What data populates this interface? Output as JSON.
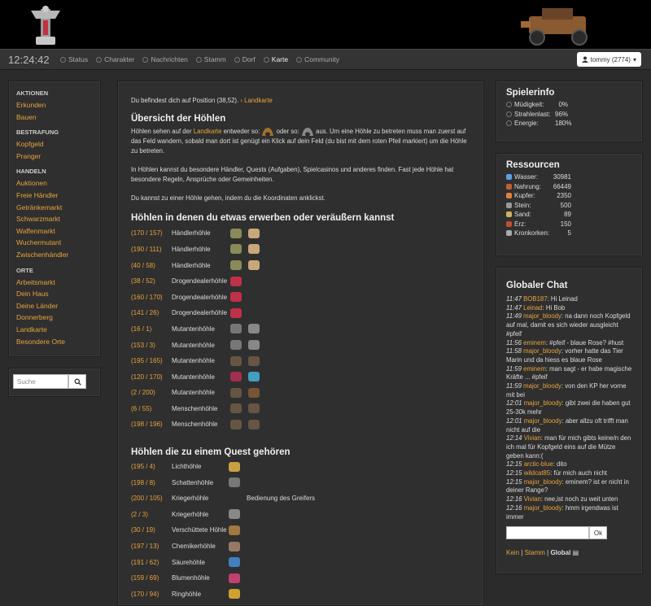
{
  "header": {
    "clock": "12:24:42"
  },
  "nav": {
    "items": [
      "Status",
      "Charakter",
      "Nachrichten",
      "Stamm",
      "Dorf",
      "Karte",
      "Community"
    ],
    "active": "Karte",
    "user": "tommy (2774)"
  },
  "sidebar": {
    "groups": [
      {
        "title": "AKTIONEN",
        "items": [
          "Erkunden",
          "Bauen"
        ]
      },
      {
        "title": "BESTRAFUNG",
        "items": [
          "Kopfgeld",
          "Pranger"
        ]
      },
      {
        "title": "HANDELN",
        "items": [
          "Auktionen",
          "Freie Händler",
          "Getränkemarkt",
          "Schwarzmarkt",
          "Waffenmarkt",
          "Wuchermutant",
          "Zwischenhändler"
        ]
      },
      {
        "title": "ORTE",
        "items": [
          "Arbeitsmarkt",
          "Dein Haus",
          "Deine Länder",
          "Donnerberg",
          "Landkarte",
          "Besondere Orte"
        ]
      }
    ]
  },
  "search": {
    "placeholder": "Suche"
  },
  "main": {
    "position_text": "Du befindest dich auf Position (38,52).",
    "position_link": "› Landkarte",
    "title": "Übersicht der Höhlen",
    "intro_a": "Höhlen sehen auf der",
    "intro_link": "Landkarte",
    "intro_b": "entweder so:",
    "intro_c": "oder so:",
    "intro_d": "aus. Um eine Höhle zu betreten muss man zuerst auf das Feld wandern, sobald man dort ist genügt ein Klick auf dein Feld (du bist mit dem roten Pfeil markiert) um die Höhle zu betreten.",
    "para2": "In Höhlen kannst du besondere Händler, Quests (Aufgaben), Spielcasinos und anderes finden. Fast jede Höhle hat besondere Regeln, Ansprüche oder Gemeinheiten.",
    "para3": "Du kannst zu einer Höhle gehen, indem du die Koordinaten anklickst.",
    "trade_title": "Höhlen in denen du etwas erwerben oder veräußern kannst",
    "trade_caves": [
      {
        "coord": "(170 / 157)",
        "name": "Händlerhöhle",
        "c1": "#8a8a5a",
        "c2": "#c8a878"
      },
      {
        "coord": "(190 / 111)",
        "name": "Händlerhöhle",
        "c1": "#8a8a5a",
        "c2": "#c8a878"
      },
      {
        "coord": "(40 / 58)",
        "name": "Händlerhöhle",
        "c1": "#8a8a5a",
        "c2": "#c8a878"
      },
      {
        "coord": "(38 / 52)",
        "name": "Drogendealerhöhle",
        "c1": "#c0304a",
        "c2": ""
      },
      {
        "coord": "(160 / 170)",
        "name": "Drogendealerhöhle",
        "c1": "#c0304a",
        "c2": ""
      },
      {
        "coord": "(141 / 26)",
        "name": "Drogendealerhöhle",
        "c1": "#c0304a",
        "c2": ""
      },
      {
        "coord": "(16 / 1)",
        "name": "Mutantenhöhle",
        "c1": "#777",
        "c2": "#888"
      },
      {
        "coord": "(153 / 3)",
        "name": "Mutantenhöhle",
        "c1": "#777",
        "c2": "#888"
      },
      {
        "coord": "(195 / 165)",
        "name": "Mutantenhöhle",
        "c1": "#665544",
        "c2": "#665544"
      },
      {
        "coord": "(120 / 170)",
        "name": "Mutantenhöhle",
        "c1": "#a03050",
        "c2": "#40a0c0"
      },
      {
        "coord": "(2 / 200)",
        "name": "Mutantenhöhle",
        "c1": "#665544",
        "c2": "#775533"
      },
      {
        "coord": "(6 / 55)",
        "name": "Menschenhöhle",
        "c1": "#665544",
        "c2": "#665544"
      },
      {
        "coord": "(198 / 196)",
        "name": "Menschenhöhle",
        "c1": "#665544",
        "c2": "#665544"
      }
    ],
    "quest_title": "Höhlen die zu einem Quest gehören",
    "quest_caves": [
      {
        "coord": "(195 / 4)",
        "name": "Lichthöhle",
        "c1": "#c8a040",
        "extra": ""
      },
      {
        "coord": "(198 / 8)",
        "name": "Schattenhöhle",
        "c1": "#777",
        "extra": ""
      },
      {
        "coord": "(200 / 105)",
        "name": "Kriegerhöhle",
        "c1": "",
        "extra": "Bedienung des Greifers"
      },
      {
        "coord": "(2 / 3)",
        "name": "Kriegerhöhle",
        "c1": "#888",
        "extra": ""
      },
      {
        "coord": "(30 / 19)",
        "name": "Verschüttete Höhle",
        "c1": "#a07840",
        "extra": ""
      },
      {
        "coord": "(197 / 13)",
        "name": "Chemikerhöhle",
        "c1": "#997766",
        "extra": ""
      },
      {
        "coord": "(191 / 62)",
        "name": "Säurehöhle",
        "c1": "#4080c0",
        "extra": ""
      },
      {
        "coord": "(159 / 69)",
        "name": "Blumenhöhle",
        "c1": "#c04070",
        "extra": ""
      },
      {
        "coord": "(170 / 94)",
        "name": "Ringhöhle",
        "c1": "#d0a030",
        "extra": ""
      }
    ]
  },
  "playerinfo": {
    "title": "Spielerinfo",
    "rows": [
      {
        "label": "Müdigkeit:",
        "value": "0%"
      },
      {
        "label": "Strahlenlast:",
        "value": "96%"
      },
      {
        "label": "Energie:",
        "value": "180%"
      }
    ]
  },
  "resources": {
    "title": "Ressourcen",
    "rows": [
      {
        "label": "Wasser:",
        "value": "30981",
        "color": "#5aa0e0"
      },
      {
        "label": "Nahrung:",
        "value": "66449",
        "color": "#c06030"
      },
      {
        "label": "Kupfer:",
        "value": "2350",
        "color": "#e08040"
      },
      {
        "label": "Stein:",
        "value": "500",
        "color": "#999"
      },
      {
        "label": "Sand:",
        "value": "89",
        "color": "#d0b060"
      },
      {
        "label": "Erz:",
        "value": "150",
        "color": "#c05030"
      },
      {
        "label": "Kronkorken:",
        "value": "5",
        "color": "#aaa"
      }
    ]
  },
  "chat": {
    "title": "Globaler Chat",
    "messages": [
      {
        "time": "11:47",
        "user": "BOB187",
        "text": ": Hi Leinad"
      },
      {
        "time": "11:47",
        "user": "Leinad",
        "text": ": Hi Bob"
      },
      {
        "time": "11:49",
        "user": "major_bloody",
        "text": ": na dann noch Kopfgeld auf mal, damit es sich wieder ausgleicht #pfeif"
      },
      {
        "time": "11:56",
        "user": "eminem",
        "text": ": #pfeif - blaue Rose? #hust"
      },
      {
        "time": "11:58",
        "user": "major_bloody",
        "text": ": vorher hatte das Tier Marin und da hiess es blaue Rose"
      },
      {
        "time": "11:59",
        "user": "eminem",
        "text": ": man sagt - er habe magische Kräfte ... #pfeif"
      },
      {
        "time": "11:59",
        "user": "major_bloody",
        "text": ": von den KP her vorne mit bei"
      },
      {
        "time": "12:01",
        "user": "major_bloody",
        "text": ": gibt zwei die haben gut 25-30k mehr"
      },
      {
        "time": "12:01",
        "user": "major_bloody",
        "text": ": aber allzu oft trifft man nicht auf die"
      },
      {
        "time": "12:14",
        "user": "Vivian",
        "text": ": man für mich gibts keine/n den ich mal für Kopfgeld eins auf die Mütze geben kann:("
      },
      {
        "time": "12:15",
        "user": "arctic-blue",
        "text": ": dito"
      },
      {
        "time": "12:15",
        "user": "wildcat85",
        "text": ": für mich auch nicht"
      },
      {
        "time": "12:15",
        "user": "major_bloody",
        "text": ": eminem? ist er nicht in deiner Range?"
      },
      {
        "time": "12:16",
        "user": "Vivian",
        "text": ": nee,ist noch zu weit unten"
      },
      {
        "time": "12:16",
        "user": "major_bloody",
        "text": ": hmm irgendwas ist immer"
      }
    ],
    "send": "Ok",
    "tab_kein": "Kein",
    "tab_stamm": "Stamm",
    "tab_global": "Global",
    "sep": "|"
  }
}
